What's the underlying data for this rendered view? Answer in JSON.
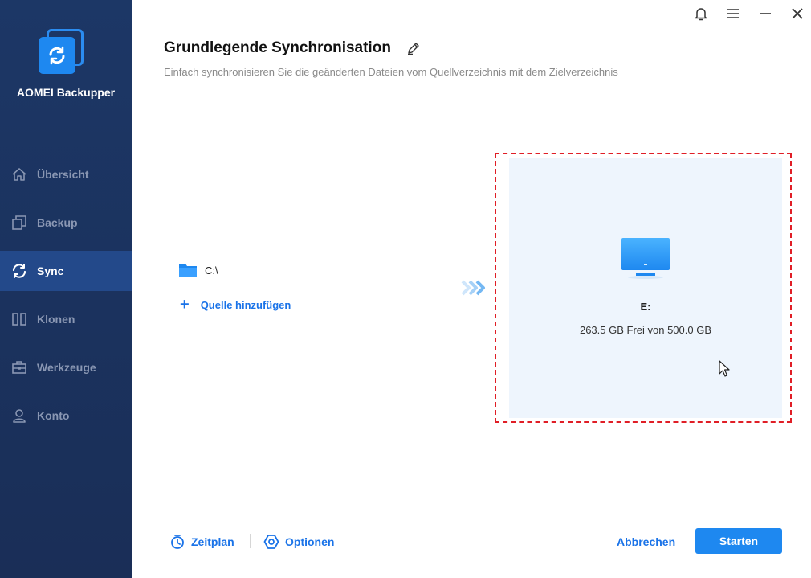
{
  "app": {
    "name": "AOMEI Backupper"
  },
  "sidebar": {
    "items": [
      {
        "label": "Übersicht",
        "icon": "home-icon"
      },
      {
        "label": "Backup",
        "icon": "backup-icon"
      },
      {
        "label": "Sync",
        "icon": "sync-icon",
        "active": true
      },
      {
        "label": "Klonen",
        "icon": "clone-icon"
      },
      {
        "label": "Werkzeuge",
        "icon": "toolbox-icon"
      },
      {
        "label": "Konto",
        "icon": "user-icon"
      }
    ]
  },
  "window_controls": [
    "bell-icon",
    "menu-icon",
    "minimize-icon",
    "close-icon"
  ],
  "header": {
    "title": "Grundlegende Synchronisation",
    "subtitle": "Einfach synchronisieren Sie die geänderten Dateien vom Quellverzeichnis mit dem Zielverzeichnis"
  },
  "source": {
    "path": "C:\\",
    "add_label": "Quelle hinzufügen"
  },
  "destination": {
    "drive": "E:",
    "free_text": "263.5 GB Frei von 500.0 GB"
  },
  "footer": {
    "schedule_label": "Zeitplan",
    "options_label": "Optionen",
    "cancel_label": "Abbrechen",
    "start_label": "Starten"
  },
  "colors": {
    "sidebar_bg": "#1c3766",
    "sidebar_active": "#23498a",
    "accent": "#1e88f0",
    "link": "#1a73e8",
    "highlight_border": "#e01e26",
    "dest_bg": "#eef5fd"
  }
}
